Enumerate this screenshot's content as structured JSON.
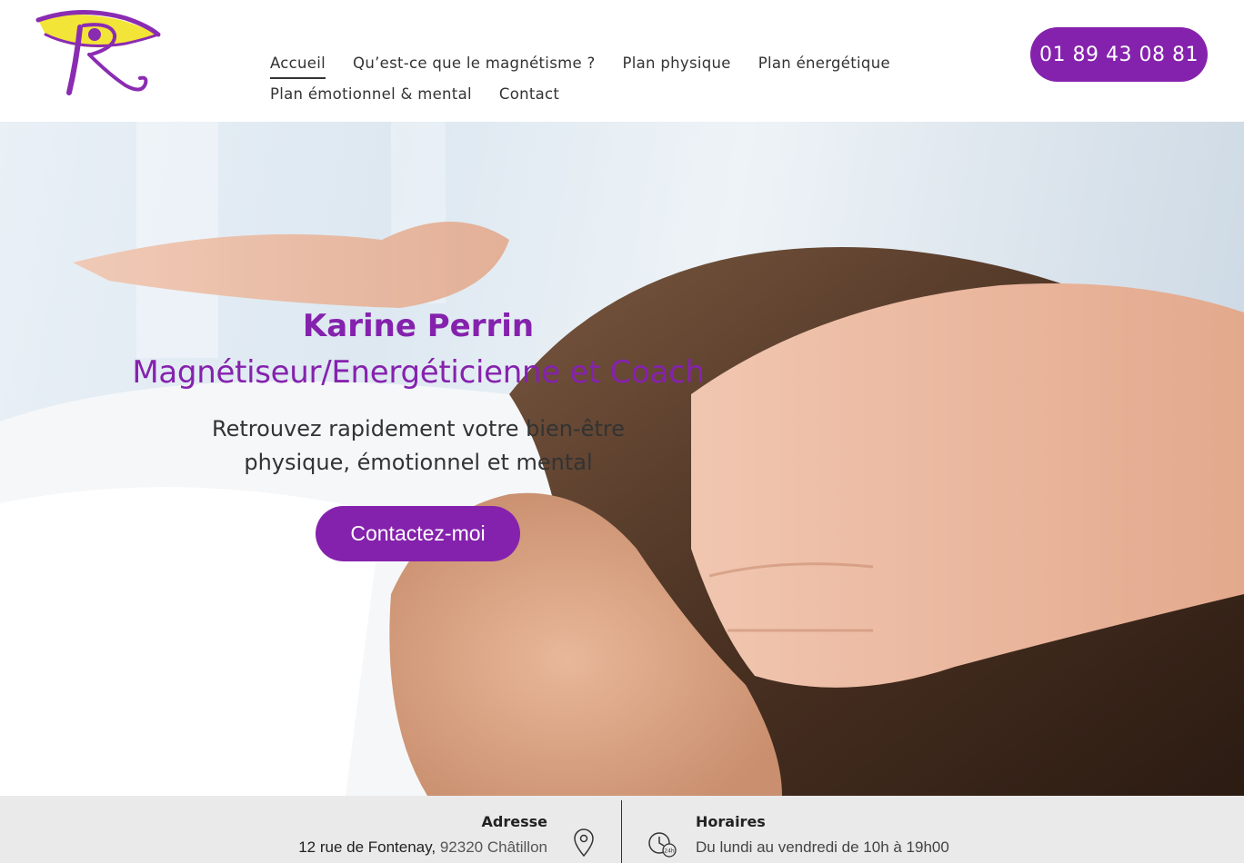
{
  "brand": {
    "logo": "eye-k-logo",
    "accent_color": "#8522ad",
    "logo_yellow": "#f2e42c"
  },
  "nav": {
    "items": [
      {
        "label": "Accueil",
        "active": true
      },
      {
        "label": "Qu’est-ce que le magnétisme ?",
        "active": false
      },
      {
        "label": "Plan physique",
        "active": false
      },
      {
        "label": "Plan énergétique",
        "active": false
      },
      {
        "label": "Plan émotionnel & mental",
        "active": false
      },
      {
        "label": "Contact",
        "active": false
      }
    ]
  },
  "header": {
    "phone": "01 89 43 08 81"
  },
  "hero": {
    "name": "Karine Perrin",
    "title": "Magnétiseur/Energéticienne et Coach",
    "subtitle_line1": "Retrouvez rapidement votre bien-être",
    "subtitle_line2": "physique, émotionnel et mental",
    "cta": "Contactez-moi"
  },
  "info": {
    "address_label": "Adresse",
    "address_street": "12 rue de Fontenay,",
    "address_city": "92320 Châtillon",
    "address_icon": "location-pin-icon",
    "hours_label": "Horaires",
    "hours_value": "Du lundi au vendredi de 10h à 19h00",
    "hours_icon": "clock-24h-icon"
  }
}
